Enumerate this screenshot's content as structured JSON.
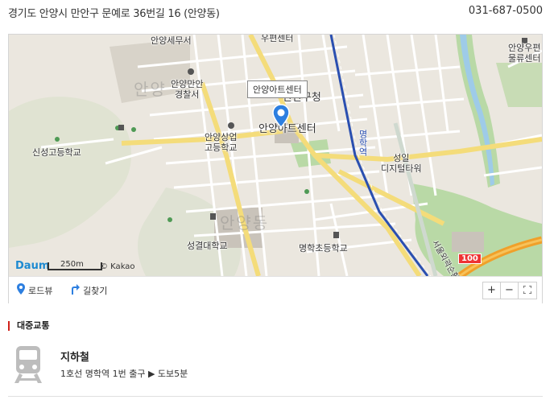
{
  "header": {
    "address": "경기도 안양시 만안구 문예로 36번길 16 (안양동)",
    "phone": "031-687-0500"
  },
  "map": {
    "labels": {
      "tax_office": "안양세무서",
      "top_center": "우편센터",
      "police": "안양만안\n경찰서",
      "callout": "안양아트센터",
      "gu_office": "만안구청",
      "art_center": "안양아트센터",
      "logistics": "안양우편\n물류센터",
      "sinseong_high": "신성고등학교",
      "commerce_high": "안양상업\n고등학교",
      "station_vertical": "명학역",
      "digital_tower": "성일\n디지털타워",
      "seongyeol_univ": "성결대학교",
      "myeonghak_elem": "명학초등학교",
      "dong_anyang": "안양동",
      "dong_left": "안양",
      "road_number": "100",
      "seoul_ring": "서울외곽순환"
    },
    "logo": "Daum",
    "scale": "250m",
    "copyright": "© Kakao"
  },
  "toolbar": {
    "roadview": "로드뷰",
    "directions": "길찾기",
    "zoom_in": "+",
    "zoom_out": "−"
  },
  "transit": {
    "section_title": "대중교통",
    "subway_title": "지하철",
    "subway_desc": "1호선 명학역 1번 출구 ▶ 도보5분"
  },
  "colors": {
    "accent_red": "#d0221b",
    "pin_blue": "#2d7fe0",
    "subway_line": "#2a4fb0",
    "road_yellow": "#f7e37c",
    "park_green": "#b9d9a6",
    "highway_orange": "#f0a02a"
  },
  "icons": {
    "roadview": "roadview-pin-icon",
    "directions": "directions-arrow-icon",
    "fullscreen": "fullscreen-icon",
    "subway": "subway-train-icon",
    "marker": "map-marker-icon"
  }
}
